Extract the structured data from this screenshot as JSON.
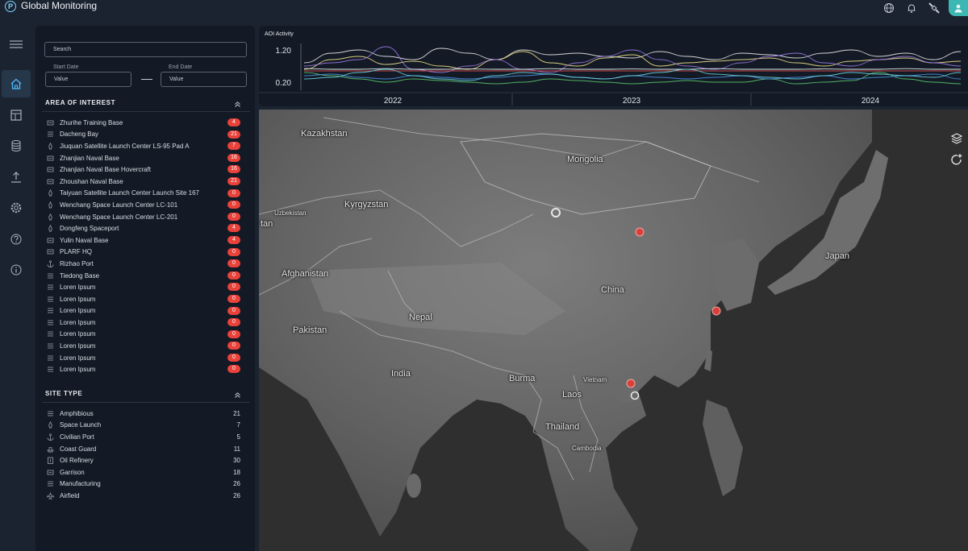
{
  "app": {
    "title": "Global Monitoring",
    "logo_letter": "P"
  },
  "header_icons": [
    "globe-icon",
    "bell-icon",
    "satellite-icon",
    "user-icon"
  ],
  "nav": [
    "menu-icon",
    "home-icon",
    "layout-icon",
    "database-icon",
    "upload-icon",
    "settings-icon",
    "help-icon",
    "info-icon"
  ],
  "filters": {
    "search_placeholder": "Search",
    "start_label": "Start Date",
    "start_value": "Value",
    "end_label": "End Date",
    "end_value": "Value"
  },
  "aoi": {
    "title": "AREA OF INTEREST",
    "items": [
      {
        "icon": "garrison",
        "label": "Zhurihe Training Base",
        "count": "4"
      },
      {
        "icon": "coast",
        "label": "Dacheng Bay",
        "count": "21"
      },
      {
        "icon": "launch",
        "label": "Jiuquan Satellite Launch Center LS-95 Pad A",
        "count": "7"
      },
      {
        "icon": "garrison",
        "label": "Zhanjian Naval Base",
        "count": "16"
      },
      {
        "icon": "garrison",
        "label": "Zhanjian Naval Base Hovercraft",
        "count": "16"
      },
      {
        "icon": "garrison",
        "label": "Zhoushan Naval Base",
        "count": "21"
      },
      {
        "icon": "launch",
        "label": "Taiyuan Satellite Launch Center Launch Site 167",
        "count": "0"
      },
      {
        "icon": "launch",
        "label": "Wenchang Space Launch Center LC-101",
        "count": "0"
      },
      {
        "icon": "launch",
        "label": "Wenchang Space Launch Center LC-201",
        "count": "0"
      },
      {
        "icon": "launch",
        "label": "Dongfeng Spaceport",
        "count": "4"
      },
      {
        "icon": "garrison",
        "label": "Yulin Naval Base",
        "count": "4"
      },
      {
        "icon": "garrison",
        "label": "PLARF HQ",
        "count": "0"
      },
      {
        "icon": "anchor",
        "label": "Rizhao Port",
        "count": "0"
      },
      {
        "icon": "coast",
        "label": "Tiedong Base",
        "count": "0"
      },
      {
        "icon": "coast",
        "label": "Loren Ipsum",
        "count": "0"
      },
      {
        "icon": "coast",
        "label": "Loren Ipsum",
        "count": "0"
      },
      {
        "icon": "coast",
        "label": "Loren Ipsum",
        "count": "0"
      },
      {
        "icon": "coast",
        "label": "Loren Ipsum",
        "count": "0"
      },
      {
        "icon": "coast",
        "label": "Loren Ipsum",
        "count": "0"
      },
      {
        "icon": "coast",
        "label": "Loren Ipsum",
        "count": "0"
      },
      {
        "icon": "coast",
        "label": "Loren Ipsum",
        "count": "0"
      },
      {
        "icon": "coast",
        "label": "Loren Ipsum",
        "count": "0"
      }
    ]
  },
  "site_type": {
    "title": "SITE TYPE",
    "items": [
      {
        "icon": "coast",
        "label": "Amphibious",
        "count": "21"
      },
      {
        "icon": "launch",
        "label": "Space Launch",
        "count": "7"
      },
      {
        "icon": "anchor",
        "label": "Civilian Port",
        "count": "5"
      },
      {
        "icon": "boat",
        "label": "Coast Guard",
        "count": "11"
      },
      {
        "icon": "refinery",
        "label": "Oil Refinery",
        "count": "30"
      },
      {
        "icon": "garrison",
        "label": "Garrison",
        "count": "18"
      },
      {
        "icon": "coast",
        "label": "Manufacturing",
        "count": "26"
      },
      {
        "icon": "plane",
        "label": "Airfield",
        "count": "26"
      }
    ]
  },
  "chart_data": {
    "type": "line",
    "title": "AOI Activity",
    "ylim": [
      0.0,
      1.4
    ],
    "yticks": [
      "1.20",
      "0.20"
    ],
    "xtick_labels": [
      "2022",
      "2023",
      "2024"
    ],
    "series": [
      {
        "color": "#e9e9e9",
        "values": [
          0.8,
          1.1,
          1.2,
          1.0,
          0.9,
          1.25,
          1.1,
          0.9,
          1.2,
          1.05,
          1.1,
          1.0,
          0.95,
          1.15,
          1.0,
          0.9,
          1.1,
          1.05,
          0.95,
          1.1,
          1.2,
          1.0,
          1.1,
          0.9,
          1.15
        ]
      },
      {
        "color": "#f1e08a",
        "values": [
          0.6,
          0.9,
          1.0,
          0.75,
          0.85,
          0.7,
          0.6,
          0.9,
          1.15,
          0.8,
          0.7,
          0.95,
          1.05,
          0.7,
          0.8,
          0.85,
          0.9,
          0.95,
          0.8,
          0.7,
          0.85,
          0.9,
          0.95,
          0.8,
          0.85
        ]
      },
      {
        "color": "#9b7ae6",
        "values": [
          0.7,
          0.8,
          0.9,
          1.3,
          0.6,
          0.5,
          0.7,
          0.9,
          0.6,
          0.5,
          0.8,
          1.0,
          1.2,
          0.9,
          0.7,
          0.6,
          0.8,
          1.0,
          1.1,
          0.8,
          0.7,
          0.9,
          1.0,
          0.8,
          0.7
        ]
      },
      {
        "color": "#5ac36a",
        "values": [
          0.5,
          0.4,
          0.3,
          0.2,
          0.3,
          0.25,
          0.2,
          0.15,
          0.2,
          0.3,
          0.25,
          0.2,
          0.15,
          0.2,
          0.25,
          0.2,
          0.2,
          0.3,
          0.15,
          0.2,
          0.25,
          0.5,
          0.3,
          0.2,
          0.15
        ]
      },
      {
        "color": "#e34c4c",
        "values": [
          0.55,
          0.55,
          0.55,
          0.55,
          0.55,
          0.55,
          0.55,
          0.55,
          0.55,
          0.55,
          0.55,
          0.55,
          0.55,
          0.55,
          0.55,
          0.55,
          0.55,
          0.55,
          0.55,
          0.55,
          0.55,
          0.55,
          0.55,
          0.55,
          0.55
        ]
      },
      {
        "color": "#4a8fe0",
        "values": [
          0.4,
          0.45,
          0.35,
          0.3,
          0.4,
          0.35,
          0.3,
          0.35,
          0.4,
          0.45,
          0.35,
          0.3,
          0.4,
          0.35,
          0.3,
          0.35,
          0.4,
          0.3,
          0.35,
          0.4,
          0.3,
          0.35,
          0.4,
          0.45,
          0.3
        ]
      },
      {
        "color": "#ffffff",
        "values": [
          0.62,
          0.6,
          0.6,
          0.62,
          0.6,
          0.6,
          0.61,
          0.6,
          0.6,
          0.62,
          0.6,
          0.6,
          0.61,
          0.6,
          0.6,
          0.62,
          0.6,
          0.6,
          0.6,
          0.61,
          0.6,
          0.6,
          0.62,
          0.6,
          0.6
        ]
      },
      {
        "color": "#6bd4e0",
        "values": [
          0.3,
          0.35,
          0.5,
          0.6,
          0.4,
          0.3,
          0.25,
          0.4,
          0.5,
          0.45,
          0.35,
          0.3,
          0.4,
          0.5,
          0.6,
          0.45,
          0.4,
          0.35,
          0.3,
          0.4,
          0.5,
          0.45,
          0.4,
          0.35,
          0.5
        ]
      }
    ]
  },
  "map": {
    "labels": [
      "Kazakhstan",
      "Mongolia",
      "Uzbekistan",
      "Kyrgyzstan",
      "Japan",
      "Afghanistan",
      "China",
      "Nepal",
      "Pakistan",
      "India",
      "Burma",
      "Vietnam",
      "Laos",
      "Thailand",
      "Cambodia",
      "tan"
    ],
    "marker_color": "#d8403a"
  }
}
